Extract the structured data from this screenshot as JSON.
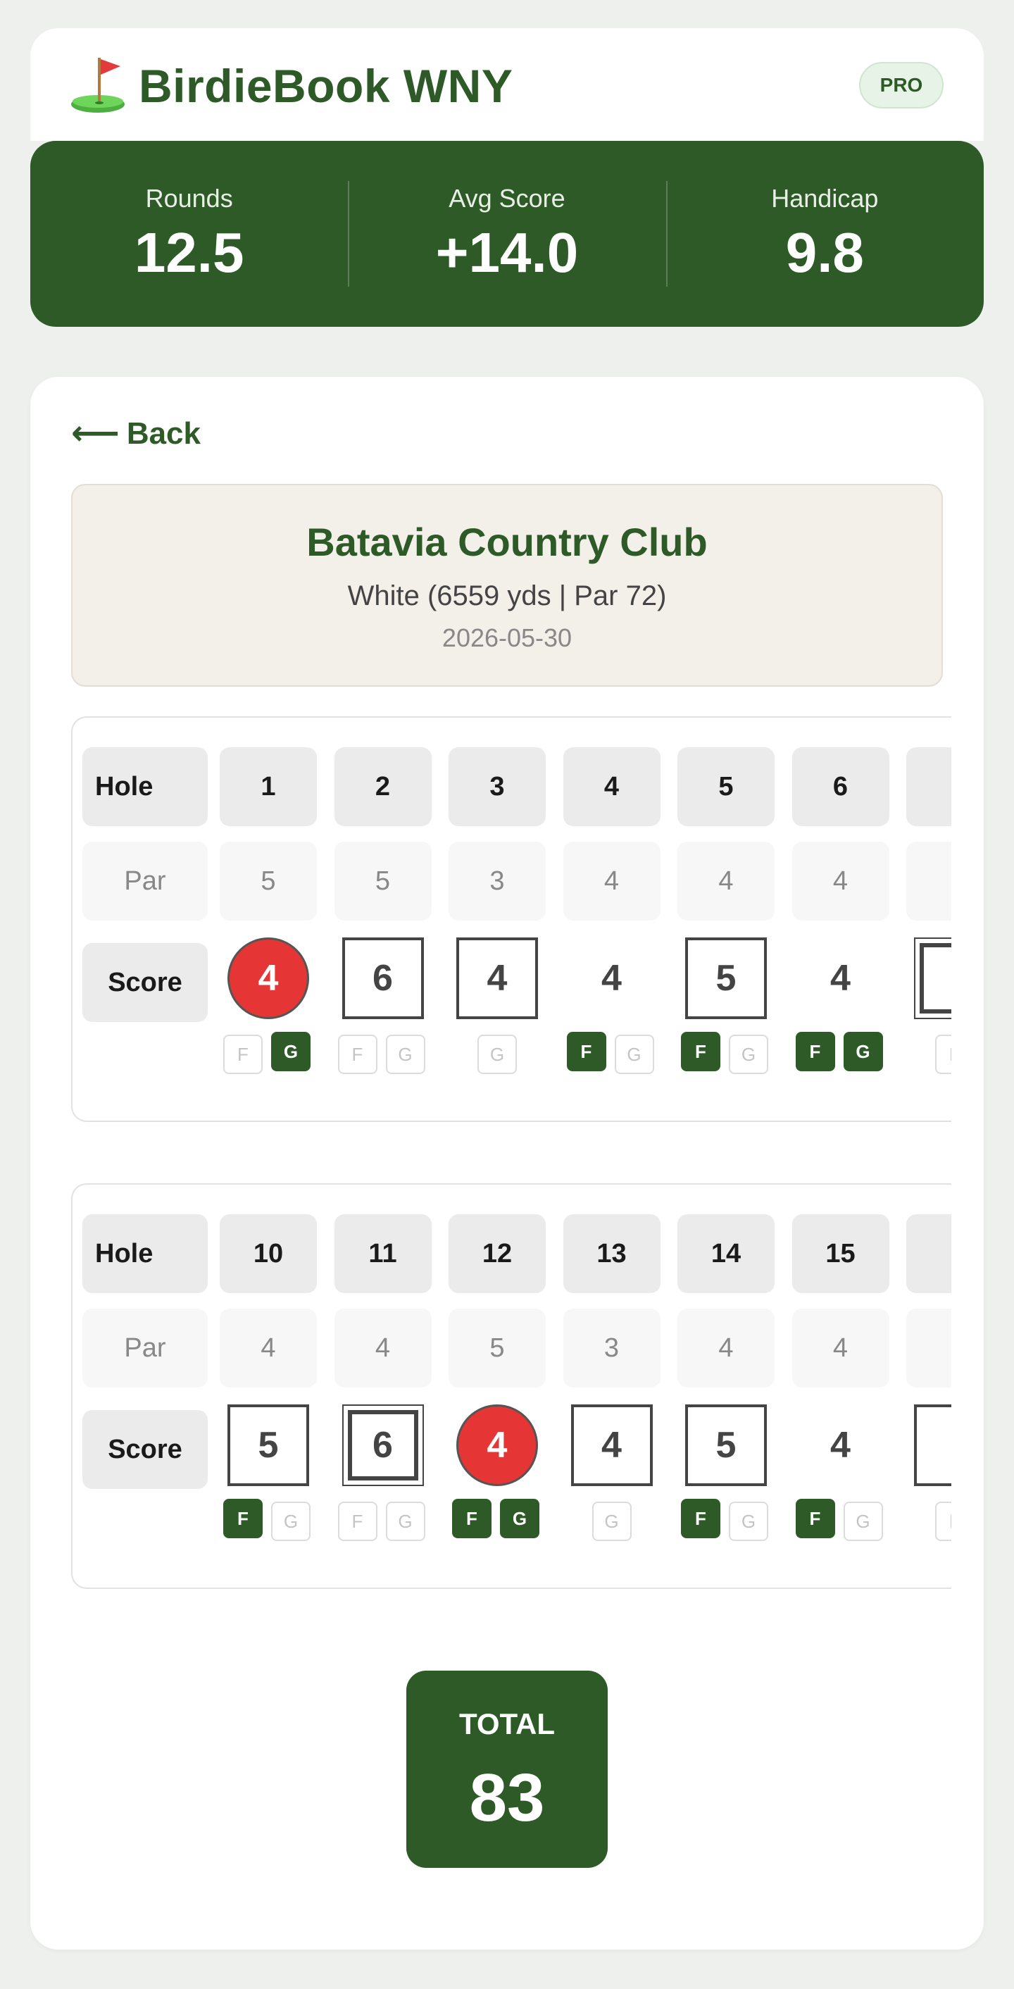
{
  "app": {
    "title": "BirdieBook WNY",
    "badge": "PRO"
  },
  "stats": [
    {
      "label": "Rounds",
      "value": "12.5"
    },
    {
      "label": "Avg Score",
      "value": "+14.0"
    },
    {
      "label": "Handicap",
      "value": "9.8"
    }
  ],
  "nav": {
    "back_label": "Back"
  },
  "course": {
    "name": "Batavia Country Club",
    "tee": "White (6559 yds | Par 72)",
    "date": "2026-05-30"
  },
  "labels": {
    "hole": "Hole",
    "par": "Par",
    "score": "Score",
    "fairway": "F",
    "green": "G"
  },
  "front_nine": {
    "holes": [
      "1",
      "2",
      "3",
      "4",
      "5",
      "6"
    ],
    "pars": [
      "5",
      "5",
      "3",
      "4",
      "4",
      "4"
    ],
    "scores": [
      "4",
      "6",
      "4",
      "4",
      "5",
      "4"
    ],
    "score_styles": [
      "birdie",
      "bogey",
      "bogey",
      "par",
      "bogey",
      "par",
      "double"
    ],
    "fg": [
      {
        "f": "off",
        "g": "on"
      },
      {
        "f": "off",
        "g": "off"
      },
      {
        "f": "none",
        "g": "off"
      },
      {
        "f": "on",
        "g": "off"
      },
      {
        "f": "on",
        "g": "off"
      },
      {
        "f": "on",
        "g": "on"
      },
      {
        "f": "off",
        "g": "none"
      }
    ]
  },
  "back_nine": {
    "holes": [
      "10",
      "11",
      "12",
      "13",
      "14",
      "15"
    ],
    "pars": [
      "4",
      "4",
      "5",
      "3",
      "4",
      "4"
    ],
    "scores": [
      "5",
      "6",
      "4",
      "4",
      "5",
      "4"
    ],
    "score_styles": [
      "bogey",
      "double",
      "birdie",
      "bogey",
      "bogey",
      "par",
      "bogey"
    ],
    "fg": [
      {
        "f": "on",
        "g": "off"
      },
      {
        "f": "off",
        "g": "off"
      },
      {
        "f": "on",
        "g": "on"
      },
      {
        "f": "none",
        "g": "off"
      },
      {
        "f": "on",
        "g": "off"
      },
      {
        "f": "on",
        "g": "off"
      },
      {
        "f": "off",
        "g": "none"
      }
    ]
  },
  "total": {
    "label": "TOTAL",
    "value": "83"
  }
}
